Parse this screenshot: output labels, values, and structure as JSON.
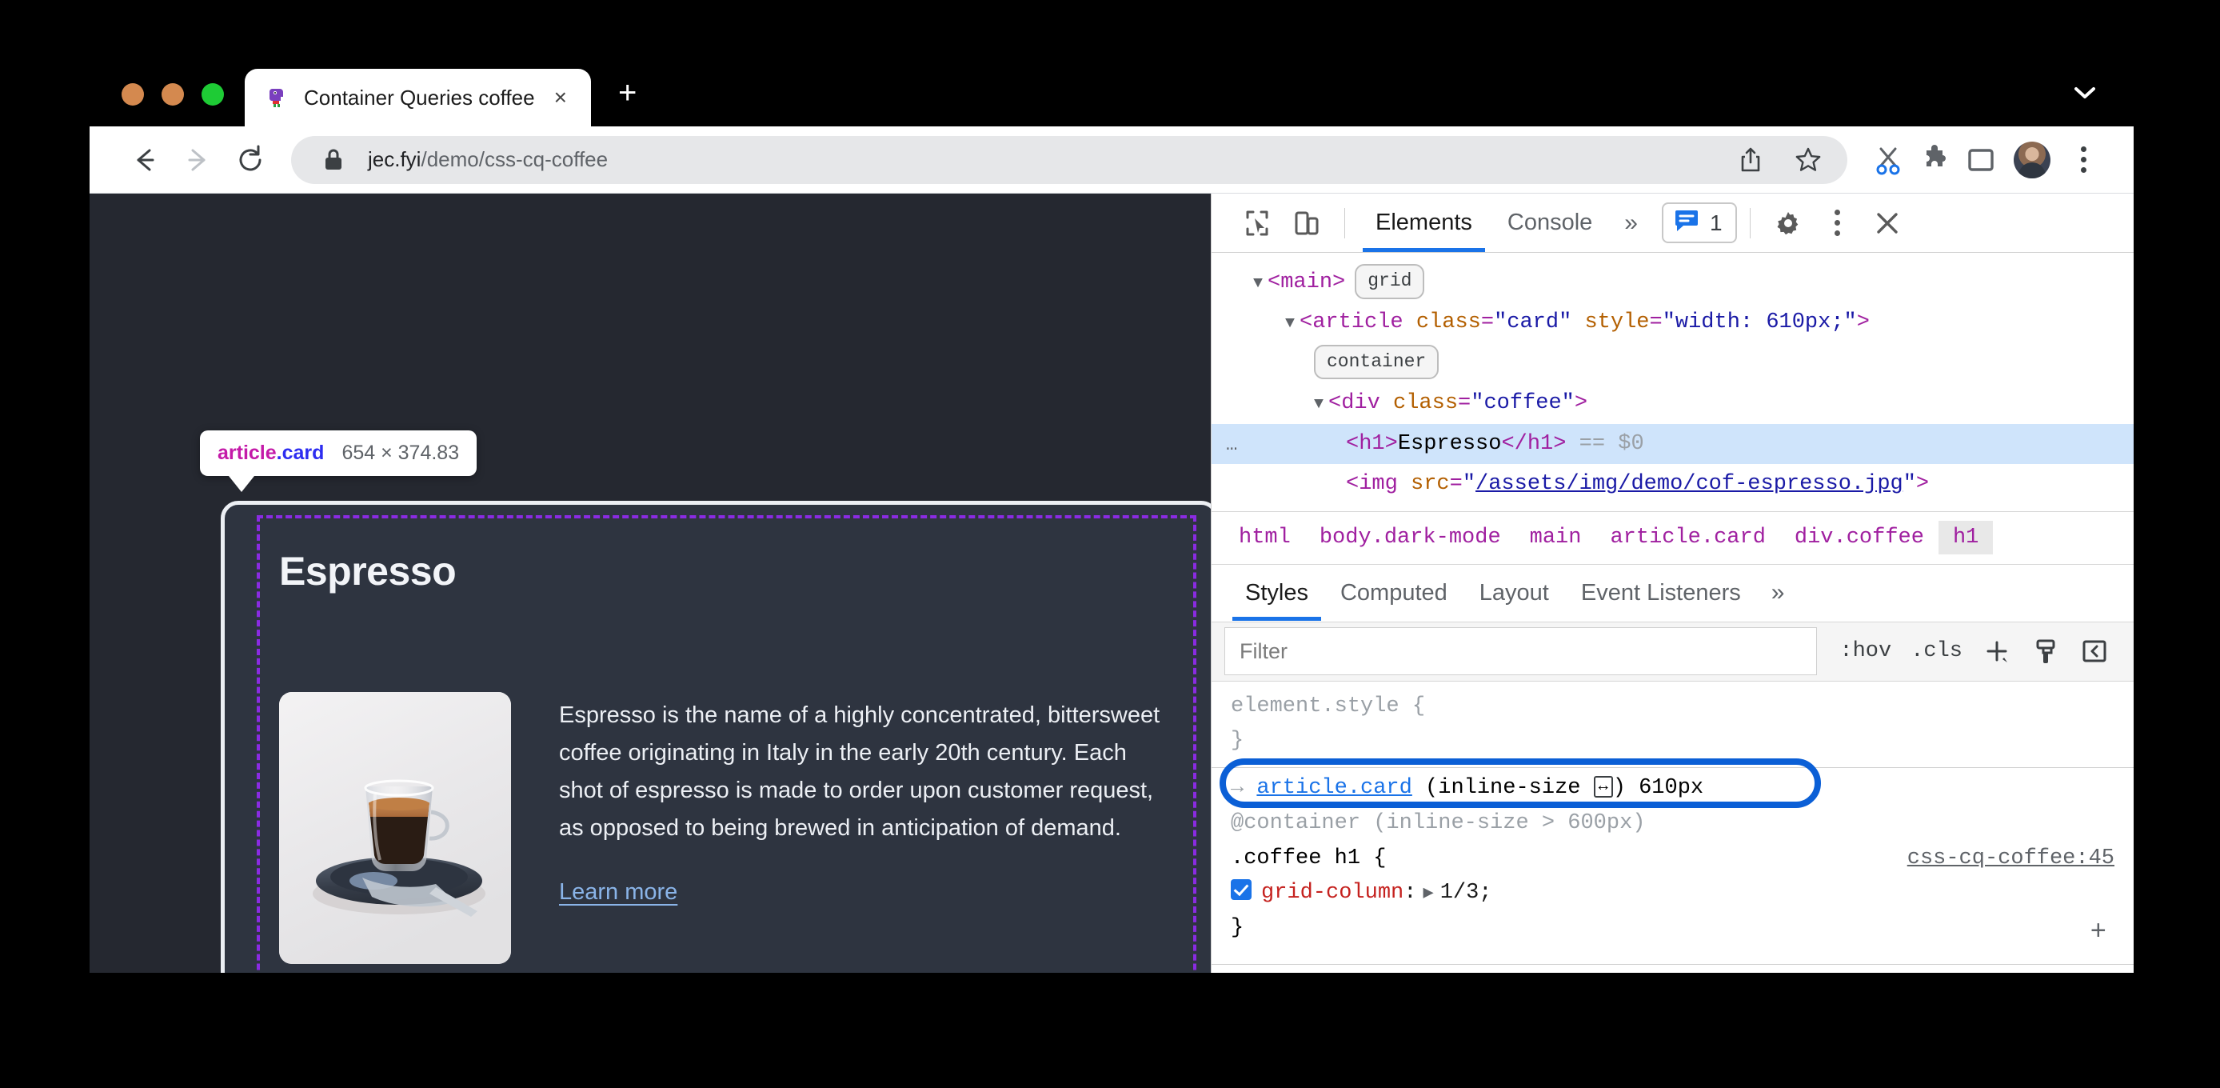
{
  "browser": {
    "tab": {
      "title": "Container Queries coffee",
      "close_label": "×",
      "favicon": "dinosaur-icon"
    },
    "new_tab_label": "+",
    "tabstrip_chevron": "chevron-down-icon",
    "nav": {
      "back": "back-arrow-icon",
      "forward": "forward-arrow-icon",
      "reload": "reload-icon"
    },
    "omnibox": {
      "lock": "lock-icon",
      "host": "jec.fyi",
      "path": "/demo/css-cq-coffee",
      "share": "share-icon",
      "bookmark": "star-icon"
    },
    "toolbar_icons": [
      "scissors-icon",
      "puzzle-icon",
      "side-panel-icon",
      "avatar",
      "three-dot-menu-icon"
    ]
  },
  "page": {
    "inspect_tooltip": {
      "tag": "article",
      "cls": ".card",
      "dimensions": "654 × 374.83"
    },
    "card": {
      "title": "Espresso",
      "body": "Espresso is the name of a highly concentrated, bittersweet coffee originating in Italy in the early 20th century. Each shot of espresso is made to order upon customer request, as opposed to being brewed in anticipation of demand.",
      "link": "Learn more",
      "image_alt": "espresso-cup-photo"
    }
  },
  "devtools": {
    "toolbar": {
      "inspect": "inspect-icon",
      "device": "device-toolbar-icon",
      "tabs": [
        {
          "label": "Elements",
          "active": true
        },
        {
          "label": "Console",
          "active": false
        }
      ],
      "more": "»",
      "message_count": "1",
      "message_icon": "message-icon",
      "settings": "gear-icon",
      "kebab": "three-dot-menu-icon",
      "close": "close-icon"
    },
    "dom": {
      "rows": [
        {
          "indent": 0,
          "triangle": "▼",
          "parts": [
            {
              "t": "tag",
              "v": "<main>"
            }
          ],
          "chip": "grid"
        },
        {
          "indent": 1,
          "triangle": "▼",
          "parts": [
            {
              "t": "tag",
              "v": "<article "
            },
            {
              "t": "attr",
              "v": "class"
            },
            {
              "t": "punct",
              "v": "="
            },
            {
              "t": "val",
              "v": "\"card\""
            },
            {
              "t": "sp",
              "v": " "
            },
            {
              "t": "attr",
              "v": "style"
            },
            {
              "t": "punct",
              "v": "="
            },
            {
              "t": "val",
              "v": "\"width: 610px;\""
            },
            {
              "t": "tag",
              "v": ">"
            }
          ]
        },
        {
          "indent": 2,
          "triangle": "",
          "parts": [],
          "chip": "container"
        },
        {
          "indent": 2,
          "triangle": "▼",
          "parts": [
            {
              "t": "tag",
              "v": "<div "
            },
            {
              "t": "attr",
              "v": "class"
            },
            {
              "t": "punct",
              "v": "="
            },
            {
              "t": "val",
              "v": "\"coffee\""
            },
            {
              "t": "tag",
              "v": ">"
            }
          ]
        },
        {
          "indent": 3,
          "triangle": "",
          "selected": true,
          "ellipsis": "…",
          "parts": [
            {
              "t": "tag",
              "v": "<h1>"
            },
            {
              "t": "text",
              "v": "Espresso"
            },
            {
              "t": "tag",
              "v": "</h1>"
            },
            {
              "t": "eq",
              "v": " == $0"
            }
          ]
        },
        {
          "indent": 3,
          "triangle": "",
          "parts": [
            {
              "t": "tag",
              "v": "<img "
            },
            {
              "t": "attr",
              "v": "src"
            },
            {
              "t": "punct",
              "v": "="
            },
            {
              "t": "val",
              "v": "\""
            },
            {
              "t": "url",
              "v": "/assets/img/demo/cof-espresso.jpg"
            },
            {
              "t": "val",
              "v": "\""
            },
            {
              "t": "tag",
              "v": ">"
            }
          ]
        }
      ]
    },
    "breadcrumbs": [
      {
        "label": "html",
        "active": false
      },
      {
        "label": "body.dark-mode",
        "active": false
      },
      {
        "label": "main",
        "active": false
      },
      {
        "label": "article.card",
        "active": false
      },
      {
        "label": "div.coffee",
        "active": false
      },
      {
        "label": "h1",
        "active": true
      }
    ],
    "styles": {
      "tabs": [
        {
          "label": "Styles",
          "active": true
        },
        {
          "label": "Computed",
          "active": false
        },
        {
          "label": "Layout",
          "active": false
        },
        {
          "label": "Event Listeners",
          "active": false
        }
      ],
      "more": "»",
      "filter_placeholder": "Filter",
      "hov_label": ":hov",
      "cls_label": ".cls",
      "new_rule_label": "+",
      "paintbrush": "paintbrush-icon",
      "sidebar_toggle": "sidebar-toggle-icon",
      "rules": {
        "element_style_open": "element.style {",
        "element_style_close": "}",
        "container_arrow": "→",
        "container_selector": "article.card",
        "container_query_text": "(inline-size",
        "container_icon": "↔",
        "container_query_tail": ") 610px",
        "at_container": "@container (inline-size > 600px)",
        "selector": ".coffee h1 {",
        "source": "css-cq-coffee:45",
        "prop": "grid-column",
        "value": "1/3;",
        "close": "}",
        "add": "+"
      }
    }
  },
  "colors": {
    "accent_blue": "#1a73e8",
    "annotation_blue": "#0b5fd6",
    "page_bg": "#252830",
    "card_bg": "#2e3440",
    "grid_overlay": "#8a2be2",
    "link_blue": "#8ab4e8"
  }
}
